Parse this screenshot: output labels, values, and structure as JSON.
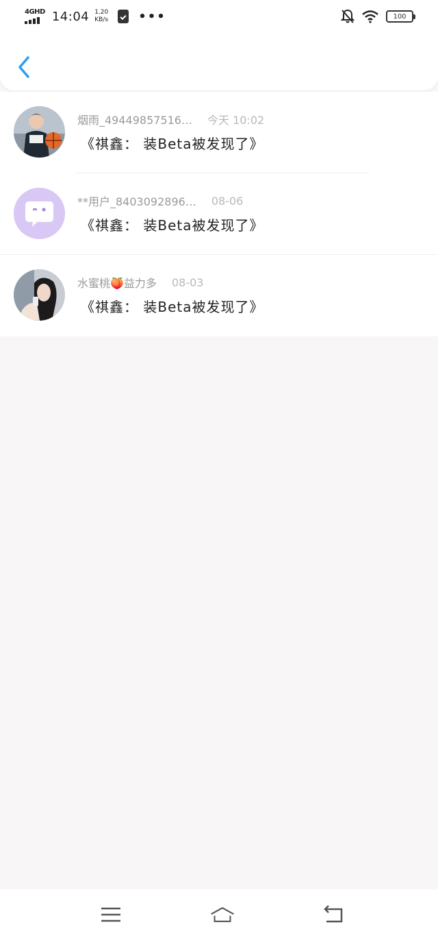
{
  "status_bar": {
    "network": "4GHD",
    "time": "14:04",
    "speed_value": "1.20",
    "speed_unit": "KB/s",
    "more": "•••",
    "battery": "100"
  },
  "header": {
    "accent_color": "#2a9df4"
  },
  "messages": [
    {
      "name": "烟雨_49449857516…",
      "time": "今天 10:02",
      "text": "《祺鑫： 装Beta被发现了》",
      "avatar": "photo-boy-basketball"
    },
    {
      "name": "**用户_8403092896…",
      "time": "08-06",
      "text": "《祺鑫： 装Beta被发现了》",
      "avatar": "default-chat-bubble",
      "avatar_color": "#d9c8f5"
    },
    {
      "name": "水蜜桃🍑益力多",
      "time": "08-03",
      "text": "《祺鑫： 装Beta被发现了》",
      "avatar": "photo-girl"
    }
  ]
}
